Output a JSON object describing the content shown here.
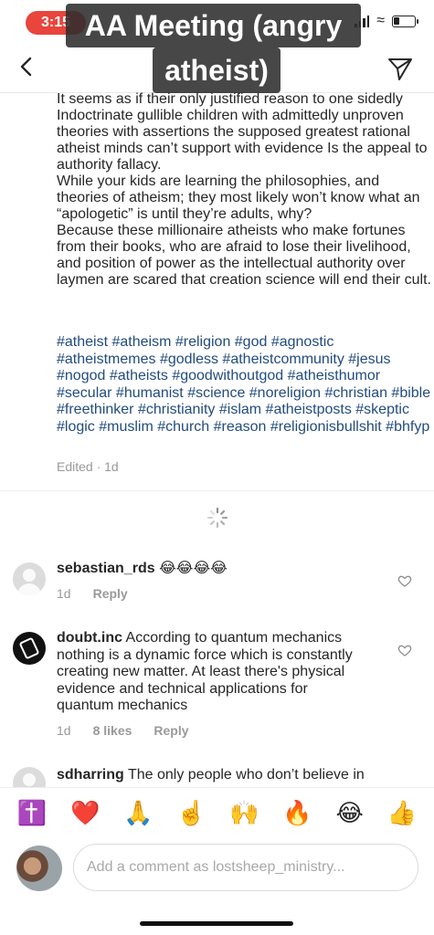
{
  "status_bar": {
    "time": "3:15"
  },
  "overlay": {
    "title_line1": "AA Meeting (angry",
    "title_line2": "atheist)"
  },
  "caption": {
    "paragraphs": [
      "It seems as if their only justified reason to one sidedly Indoctrinate gullible children with admittedly unproven theories with assertions the supposed greatest rational atheist minds can’t support with evidence Is the appeal to authority fallacy.",
      "While your kids are learning the philosophies, and theories of atheism; they most likely won’t know what an “apologetic” is until they’re adults, why?",
      "Because these millionaire atheists who make fortunes from their books, who are  afraid to lose their livelihood, and position of power as the intellectual authority over laymen are scared that creation science will end their cult."
    ],
    "hashtags": "#atheist #atheism #religion #god #agnostic #atheistmemes #godless #atheistcommunity #jesus #nogod #atheists #goodwithoutgod #atheisthumor #secular #humanist #science #noreligion #christian #bible #freethinker #christianity #islam #atheistposts #skeptic #logic #muslim #church #reason #religionisbullshit #bhfyp",
    "edited": "Edited · 1d"
  },
  "comments": [
    {
      "username": "sebastian_rds",
      "text": "😂😂😂😂",
      "age": "1d",
      "likes": "",
      "reply": "Reply"
    },
    {
      "username": "doubt.inc",
      "text": "According to quantum mechanics nothing is a dynamic force which is constantly creating new matter. At least there's physical evidence and technical applications for quantum mechanics",
      "age": "1d",
      "likes": "8 likes",
      "reply": "Reply"
    },
    {
      "username": "sdharring",
      "text": "The only people who don’t believe in"
    }
  ],
  "emoji_bar": [
    "✝️",
    "❤️",
    "🙏",
    "☝️",
    "🙌",
    "🔥",
    "😂",
    "👍"
  ],
  "comment_input": {
    "placeholder": "Add a comment as lostsheep_ministry..."
  }
}
